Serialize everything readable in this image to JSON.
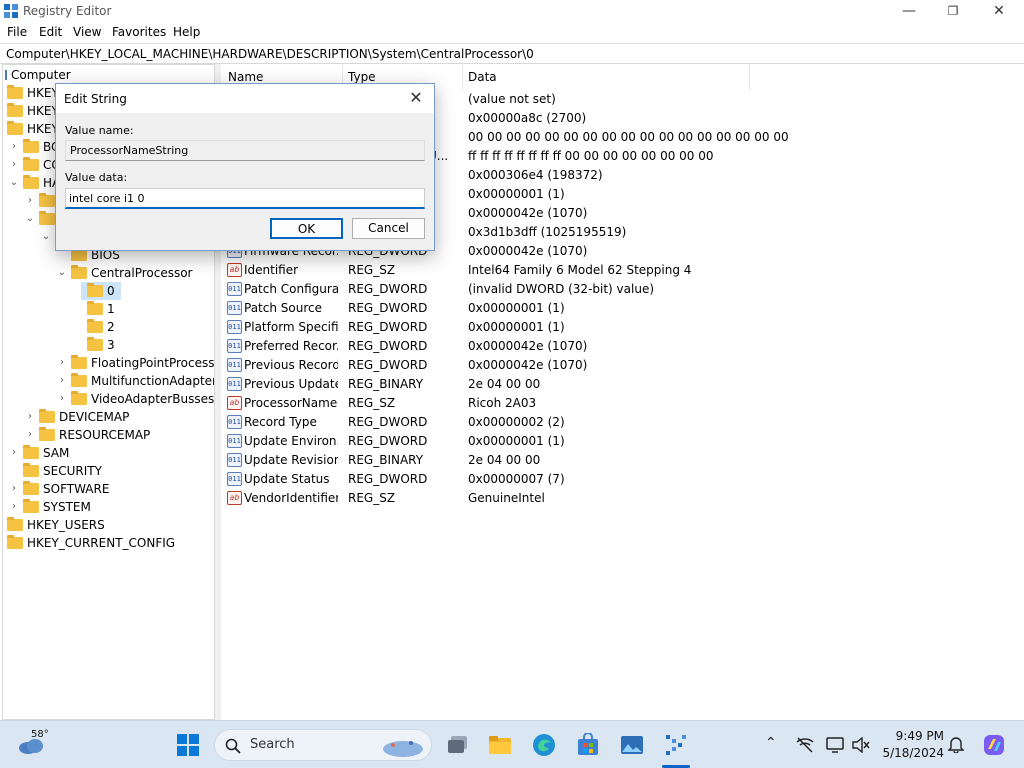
{
  "window": {
    "title": "Registry Editor",
    "minimize": "—",
    "maximize": "❐",
    "close": "✕"
  },
  "menu": [
    "File",
    "Edit",
    "View",
    "Favorites",
    "Help"
  ],
  "address": "Computer\\HKEY_LOCAL_MACHINE\\HARDWARE\\DESCRIPTION\\System\\CentralProcessor\\0",
  "tree": {
    "root": "Computer",
    "hkcr": "HKEY",
    "hkcu": "HKEY",
    "hklm": "HKEY",
    "bcd": "BC",
    "components": "CO",
    "hardware": "HA",
    "bios": "BIOS",
    "centralprocessor": "CentralProcessor",
    "cp0": "0",
    "cp1": "1",
    "cp2": "2",
    "cp3": "3",
    "floatingpoint": "FloatingPointProcessor",
    "multifunction": "MultifunctionAdapter",
    "videoadapter": "VideoAdapterBusses",
    "devicemap": "DEVICEMAP",
    "resourcemap": "RESOURCEMAP",
    "sam": "SAM",
    "security": "SECURITY",
    "software": "SOFTWARE",
    "system": "SYSTEM",
    "hkusers": "HKEY_USERS",
    "hkcc": "HKEY_CURRENT_CONFIG"
  },
  "list": {
    "headers": {
      "name": "Name",
      "type": "Type",
      "data": "Data"
    },
    "hidden_rows": [
      {
        "type": "",
        "data": "(value not set)"
      },
      {
        "type": "",
        "data": "0x00000a8c (2700)"
      },
      {
        "type": "",
        "data": "00 00 00 00 00 00 00 00 00 00 00 00 00 00 00 00 00"
      },
      {
        "type": "U...",
        "data": "ff ff ff ff ff ff ff ff 00 00 00 00 00 00 00 00"
      },
      {
        "type": "",
        "data": "0x000306e4 (198372)"
      },
      {
        "type": "",
        "data": "0x00000001 (1)"
      },
      {
        "type": "",
        "data": "0x0000042e (1070)"
      },
      {
        "type": "",
        "data": "0x3d1b3dff (1025195519)"
      }
    ],
    "rows": [
      {
        "icon": "dword",
        "name": "Firmware Recor...",
        "type": "REG_DWORD",
        "data": "0x0000042e (1070)"
      },
      {
        "icon": "sz",
        "name": "Identifier",
        "type": "REG_SZ",
        "data": "Intel64 Family 6 Model 62 Stepping 4"
      },
      {
        "icon": "dword",
        "name": "Patch Configura...",
        "type": "REG_DWORD",
        "data": "(invalid DWORD (32-bit) value)"
      },
      {
        "icon": "dword",
        "name": "Patch Source",
        "type": "REG_DWORD",
        "data": "0x00000001 (1)"
      },
      {
        "icon": "dword",
        "name": "Platform Specifi...",
        "type": "REG_DWORD",
        "data": "0x00000001 (1)"
      },
      {
        "icon": "dword",
        "name": "Preferred Recor...",
        "type": "REG_DWORD",
        "data": "0x0000042e (1070)"
      },
      {
        "icon": "dword",
        "name": "Previous Record...",
        "type": "REG_DWORD",
        "data": "0x0000042e (1070)"
      },
      {
        "icon": "dword",
        "name": "Previous Update...",
        "type": "REG_BINARY",
        "data": "2e 04 00 00"
      },
      {
        "icon": "sz",
        "name": "ProcessorName...",
        "type": "REG_SZ",
        "data": "Ricoh 2A03"
      },
      {
        "icon": "dword",
        "name": "Record Type",
        "type": "REG_DWORD",
        "data": "0x00000002 (2)"
      },
      {
        "icon": "dword",
        "name": "Update Environ...",
        "type": "REG_DWORD",
        "data": "0x00000001 (1)"
      },
      {
        "icon": "dword",
        "name": "Update Revision",
        "type": "REG_BINARY",
        "data": "2e 04 00 00"
      },
      {
        "icon": "dword",
        "name": "Update Status",
        "type": "REG_DWORD",
        "data": "0x00000007 (7)"
      },
      {
        "icon": "sz",
        "name": "VendorIdentifier",
        "type": "REG_SZ",
        "data": "GenuineIntel"
      }
    ],
    "icon_text": {
      "sz": "ab",
      "dword": "011"
    }
  },
  "dialog": {
    "title": "Edit String",
    "value_name_label": "Value name:",
    "value_name": "ProcessorNameString",
    "value_data_label": "Value data:",
    "value_data": "intel core i1 0",
    "ok": "OK",
    "cancel": "Cancel"
  },
  "taskbar": {
    "weather_temp": "58°",
    "search_placeholder": "Search",
    "time": "9:49 PM",
    "date": "5/18/2024"
  },
  "colors": {
    "accent": "#0067c0",
    "taskbar": "#dbe6f3",
    "folder": "#f5c242",
    "selection": "#cce4f7"
  }
}
